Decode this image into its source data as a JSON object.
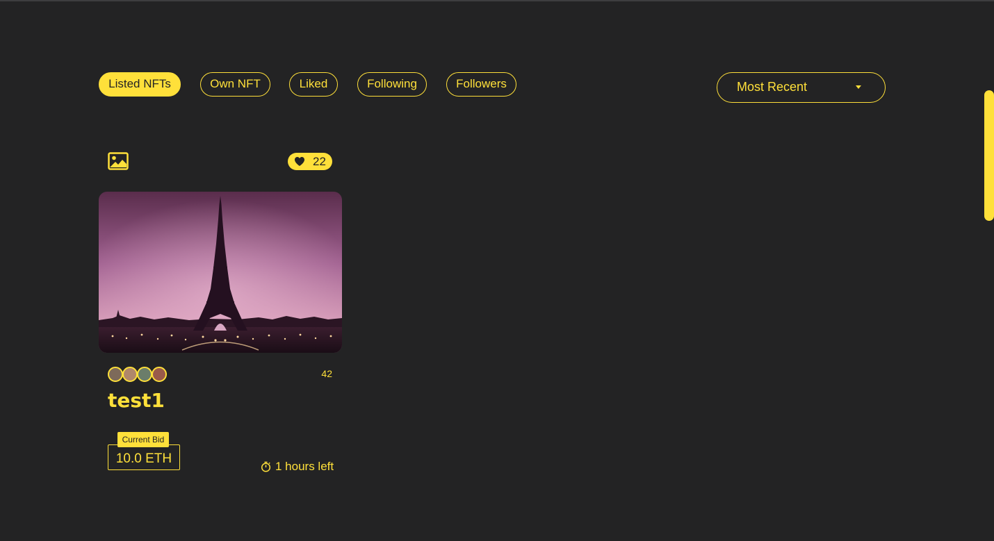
{
  "tabs": [
    {
      "label": "Listed NFTs",
      "active": true
    },
    {
      "label": "Own NFT",
      "active": false
    },
    {
      "label": "Liked",
      "active": false
    },
    {
      "label": "Following",
      "active": false
    },
    {
      "label": "Followers",
      "active": false
    }
  ],
  "sort": {
    "label": "Most Recent",
    "icon": "caret-down-icon"
  },
  "colors": {
    "background": "#232324",
    "accent": "#FFE03A"
  },
  "card": {
    "type_icon": "image-icon",
    "likes": "22",
    "like_icon": "heart-icon",
    "owners_count": "42",
    "title": "test1",
    "bid_label": "Current Bid",
    "bid_value": "10.0 ETH",
    "time_left": "1 hours left",
    "timer_icon": "stopwatch-icon"
  }
}
